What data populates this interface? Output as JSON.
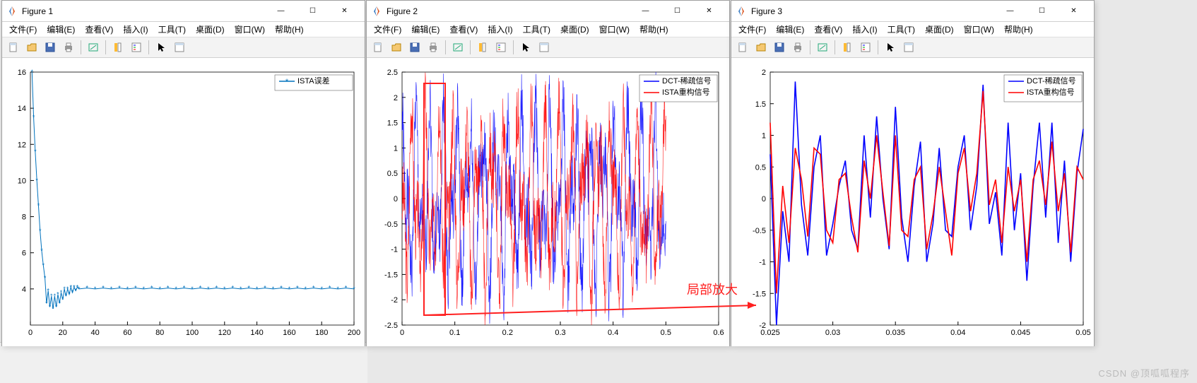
{
  "watermark": "CSDN @顶呱呱程序",
  "windows": [
    {
      "title": "Figure 1"
    },
    {
      "title": "Figure 2"
    },
    {
      "title": "Figure 3"
    }
  ],
  "menus": {
    "file": "文件(F)",
    "edit": "编辑(E)",
    "view": "查看(V)",
    "insert": "插入(I)",
    "tools": "工具(T)",
    "desktop": "桌面(D)",
    "window": "窗口(W)",
    "help": "帮助(H)"
  },
  "win_btns": {
    "min": "—",
    "max": "☐",
    "close": "✕"
  },
  "annotation_text": "局部放大",
  "chart_data": [
    {
      "type": "line",
      "title": "",
      "xlabel": "",
      "ylabel": "",
      "xlim": [
        0,
        200
      ],
      "ylim": [
        2,
        16
      ],
      "xticks": [
        0,
        20,
        40,
        60,
        80,
        100,
        120,
        140,
        160,
        180,
        200
      ],
      "yticks": [
        4,
        6,
        8,
        10,
        12,
        14,
        16
      ],
      "legend": [
        "ISTA误差"
      ],
      "series": [
        {
          "name": "ISTA误差",
          "color": "#0072bd",
          "marker": "star",
          "x": [
            1,
            2,
            3,
            4,
            5,
            6,
            7,
            8,
            9,
            10,
            11,
            12,
            13,
            14,
            15,
            16,
            17,
            18,
            19,
            20,
            21,
            22,
            23,
            24,
            25,
            26,
            27,
            28,
            29,
            30,
            35,
            40,
            45,
            50,
            55,
            60,
            65,
            70,
            75,
            80,
            85,
            90,
            95,
            100,
            105,
            110,
            115,
            120,
            125,
            130,
            135,
            140,
            145,
            150,
            155,
            160,
            165,
            170,
            175,
            180,
            185,
            190,
            195,
            200
          ],
          "y": [
            16.0,
            13.5,
            11.6,
            10.0,
            8.6,
            7.2,
            6.1,
            5.3,
            4.6,
            3.2,
            3.9,
            3.0,
            3.6,
            2.9,
            3.6,
            3.0,
            3.7,
            3.2,
            3.8,
            3.4,
            4.0,
            3.6,
            4.0,
            3.7,
            4.1,
            3.8,
            4.1,
            3.9,
            4.1,
            4.0,
            4.05,
            4.0,
            4.05,
            4.0,
            4.05,
            4.0,
            4.05,
            4.0,
            4.05,
            4.0,
            4.05,
            4.0,
            4.05,
            4.0,
            4.05,
            4.0,
            4.05,
            4.0,
            4.05,
            4.0,
            4.05,
            4.0,
            4.05,
            4.0,
            4.05,
            4.0,
            4.05,
            4.0,
            4.05,
            4.0,
            4.05,
            4.0,
            4.05,
            4.0
          ]
        }
      ]
    },
    {
      "type": "line",
      "title": "",
      "xlabel": "",
      "ylabel": "",
      "xlim": [
        0,
        0.6
      ],
      "ylim": [
        -2.5,
        2.5
      ],
      "xticks": [
        0,
        0.1,
        0.2,
        0.3,
        0.4,
        0.5,
        0.6
      ],
      "yticks": [
        -2.5,
        -2,
        -1.5,
        -1,
        -0.5,
        0,
        0.5,
        1,
        1.5,
        2,
        2.5
      ],
      "legend": [
        "DCT-稀疏信号",
        "ISTA重构信号"
      ],
      "series": [
        {
          "name": "DCT-稀疏信号",
          "color": "#0000ff"
        },
        {
          "name": "ISTA重构信号",
          "color": "#ff0000"
        }
      ],
      "note": "dense oscillatory signal, amplitude ≈ ±2.2, domain 0..0.5"
    },
    {
      "type": "line",
      "title": "",
      "xlabel": "",
      "ylabel": "",
      "xlim": [
        0.025,
        0.05
      ],
      "ylim": [
        -2,
        2
      ],
      "xticks": [
        0.025,
        0.03,
        0.035,
        0.04,
        0.045,
        0.05
      ],
      "yticks": [
        -2,
        -1.5,
        -1,
        -0.5,
        0,
        0.5,
        1,
        1.5,
        2
      ],
      "legend": [
        "DCT-稀疏信号",
        "ISTA重构信号"
      ],
      "series": [
        {
          "name": "DCT-稀疏信号",
          "color": "#0000ff",
          "x": [
            0.025,
            0.0255,
            0.026,
            0.0265,
            0.027,
            0.0275,
            0.028,
            0.0285,
            0.029,
            0.0295,
            0.03,
            0.0305,
            0.031,
            0.0315,
            0.032,
            0.0325,
            0.033,
            0.0335,
            0.034,
            0.0345,
            0.035,
            0.0355,
            0.036,
            0.0365,
            0.037,
            0.0375,
            0.038,
            0.0385,
            0.039,
            0.0395,
            0.04,
            0.0405,
            0.041,
            0.0415,
            0.042,
            0.0425,
            0.043,
            0.0435,
            0.044,
            0.0445,
            0.045,
            0.0455,
            0.046,
            0.0465,
            0.047,
            0.0475,
            0.048,
            0.0485,
            0.049,
            0.0495,
            0.05
          ],
          "y": [
            0.7,
            -2.0,
            -0.2,
            -1.0,
            1.85,
            -0.1,
            -0.9,
            0.5,
            1.0,
            -0.9,
            -0.4,
            0.2,
            0.6,
            -0.5,
            -0.8,
            1.0,
            -0.3,
            1.3,
            0.0,
            -0.8,
            1.45,
            -0.3,
            -1.0,
            0.2,
            0.9,
            -1.0,
            -0.4,
            0.8,
            -0.5,
            -0.6,
            0.5,
            1.0,
            -0.5,
            0.2,
            1.8,
            -0.4,
            0.1,
            -0.9,
            1.2,
            -0.5,
            0.4,
            -1.3,
            0.2,
            1.2,
            -0.3,
            1.2,
            -0.7,
            0.6,
            -1.0,
            0.4,
            1.1
          ]
        },
        {
          "name": "ISTA重构信号",
          "color": "#ff0000",
          "x": [
            0.025,
            0.0255,
            0.026,
            0.0265,
            0.027,
            0.0275,
            0.028,
            0.0285,
            0.029,
            0.0295,
            0.03,
            0.0305,
            0.031,
            0.0315,
            0.032,
            0.0325,
            0.033,
            0.0335,
            0.034,
            0.0345,
            0.035,
            0.0355,
            0.036,
            0.0365,
            0.037,
            0.0375,
            0.038,
            0.0385,
            0.039,
            0.0395,
            0.04,
            0.0405,
            0.041,
            0.0415,
            0.042,
            0.0425,
            0.043,
            0.0435,
            0.044,
            0.0445,
            0.045,
            0.0455,
            0.046,
            0.0465,
            0.047,
            0.0475,
            0.048,
            0.0485,
            0.049,
            0.0495,
            0.05
          ],
          "y": [
            1.2,
            -1.5,
            0.2,
            -0.7,
            0.8,
            0.3,
            -0.6,
            0.8,
            0.7,
            -0.5,
            -0.7,
            0.3,
            0.4,
            -0.3,
            -0.85,
            0.6,
            0.0,
            1.0,
            0.1,
            -0.75,
            1.0,
            -0.5,
            -0.6,
            0.3,
            0.5,
            -0.8,
            -0.25,
            0.5,
            -0.2,
            -0.9,
            0.4,
            0.8,
            -0.2,
            0.4,
            1.7,
            -0.1,
            0.3,
            -0.7,
            0.5,
            -0.2,
            0.3,
            -1.0,
            0.3,
            0.6,
            -0.1,
            0.9,
            -0.2,
            0.4,
            -0.85,
            0.5,
            0.3
          ]
        }
      ]
    }
  ]
}
